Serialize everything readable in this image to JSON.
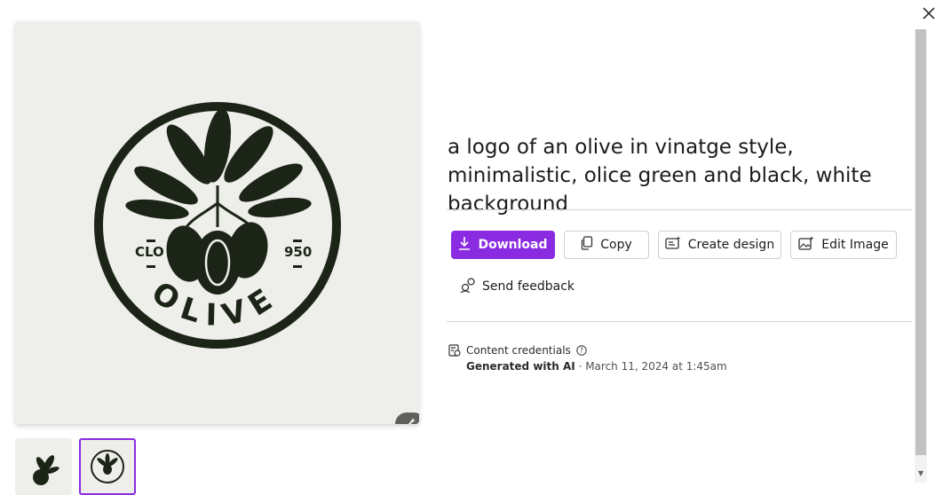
{
  "image": {
    "logo_text": "OLIVE",
    "logo_left_text": "CLO",
    "logo_right_text": "950"
  },
  "prompt": {
    "text": "a logo of an olive in vinatge style, minimalistic, olice green and black, white background"
  },
  "actions": {
    "download_label": "Download",
    "copy_label": "Copy",
    "create_design_label": "Create design",
    "edit_image_label": "Edit Image",
    "send_feedback_label": "Send feedback"
  },
  "credentials": {
    "title": "Content credentials",
    "generated_label": "Generated with AI",
    "separator": " · ",
    "date": "March 11, 2024 at 1:45am"
  },
  "colors": {
    "accent": "#8a2be2",
    "logo_dark": "#1c2417",
    "image_bg": "#eeeeea"
  },
  "icons": [
    "close-icon",
    "magic-wand-icon",
    "download-icon",
    "copy-icon",
    "create-design-icon",
    "edit-image-icon",
    "feedback-icon",
    "content-credentials-icon",
    "help-icon"
  ]
}
